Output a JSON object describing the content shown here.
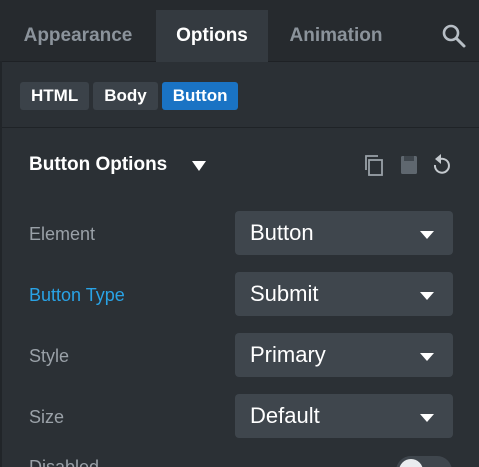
{
  "tabs": [
    {
      "label": "Appearance",
      "active": false
    },
    {
      "label": "Options",
      "active": true
    },
    {
      "label": "Animation",
      "active": false
    }
  ],
  "search_icon": "search-icon",
  "breadcrumbs": [
    {
      "label": "HTML",
      "active": false
    },
    {
      "label": "Body",
      "active": false
    },
    {
      "label": "Button",
      "active": true
    }
  ],
  "section": {
    "title": "Button Options",
    "tools": [
      "copy-icon",
      "save-icon",
      "reset-icon"
    ]
  },
  "fields": [
    {
      "label": "Element",
      "value": "Button",
      "linked": false
    },
    {
      "label": "Button Type",
      "value": "Submit",
      "linked": true
    },
    {
      "label": "Style",
      "value": "Primary",
      "linked": false
    },
    {
      "label": "Size",
      "value": "Default",
      "linked": false
    }
  ],
  "disabled": {
    "label": "Disabled",
    "on": false
  },
  "colors": {
    "accent": "#1a73c4",
    "link": "#29a3e6",
    "background": "#2b3035"
  }
}
